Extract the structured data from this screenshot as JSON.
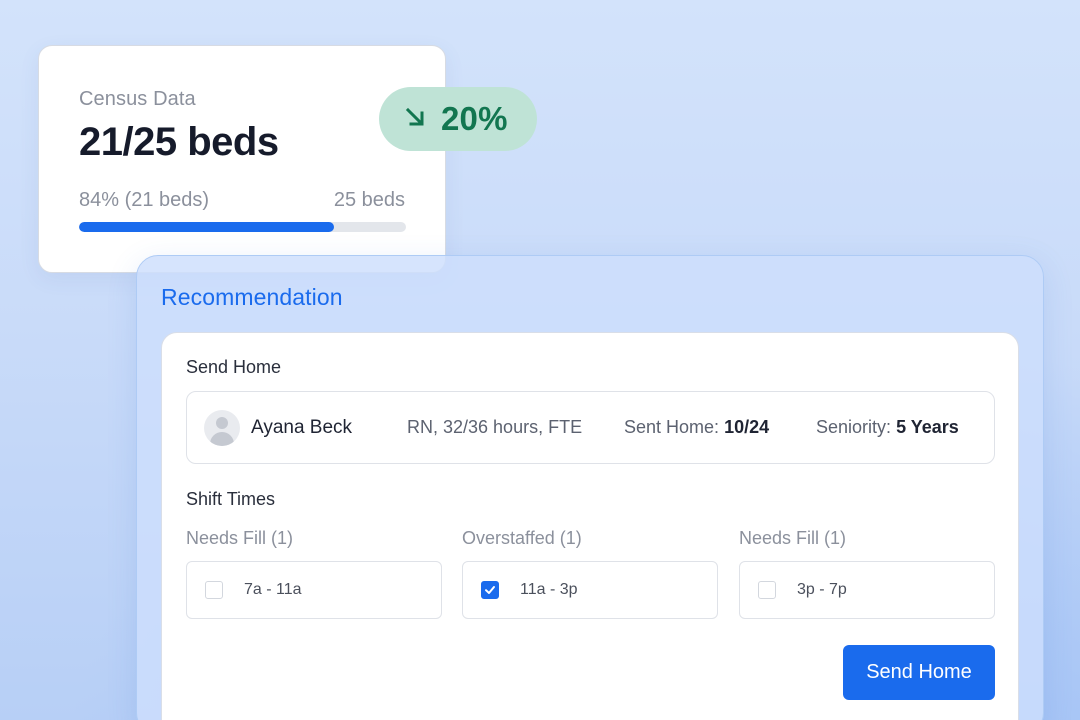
{
  "census": {
    "label": "Census Data",
    "value": "21/25 beds",
    "occupied_label": "84% (21 beds)",
    "total_label": "25 beds",
    "progress_fraction": 0.78
  },
  "trend": {
    "icon": "arrow-down-right-icon",
    "value": "20%",
    "color": "#127650"
  },
  "recommendation": {
    "title": "Recommendation",
    "send_home_title": "Send Home",
    "staff": {
      "name": "Ayana Beck",
      "role": "RN, 32/36 hours, FTE",
      "sent_home_label": "Sent Home:",
      "sent_home_value": "10/24",
      "seniority_label": "Seniority:",
      "seniority_value": "5 Years"
    },
    "shift_title": "Shift Times",
    "shifts": [
      {
        "status": "Needs Fill (1)",
        "time": "7a - 11a",
        "checked": false
      },
      {
        "status": "Overstaffed (1)",
        "time": "11a - 3p",
        "checked": true
      },
      {
        "status": "Needs Fill (1)",
        "time": "3p - 7p",
        "checked": false
      }
    ],
    "button_label": "Send Home"
  },
  "colors": {
    "accent": "#1a6bed",
    "trend_bg": "#bfe3d6"
  }
}
